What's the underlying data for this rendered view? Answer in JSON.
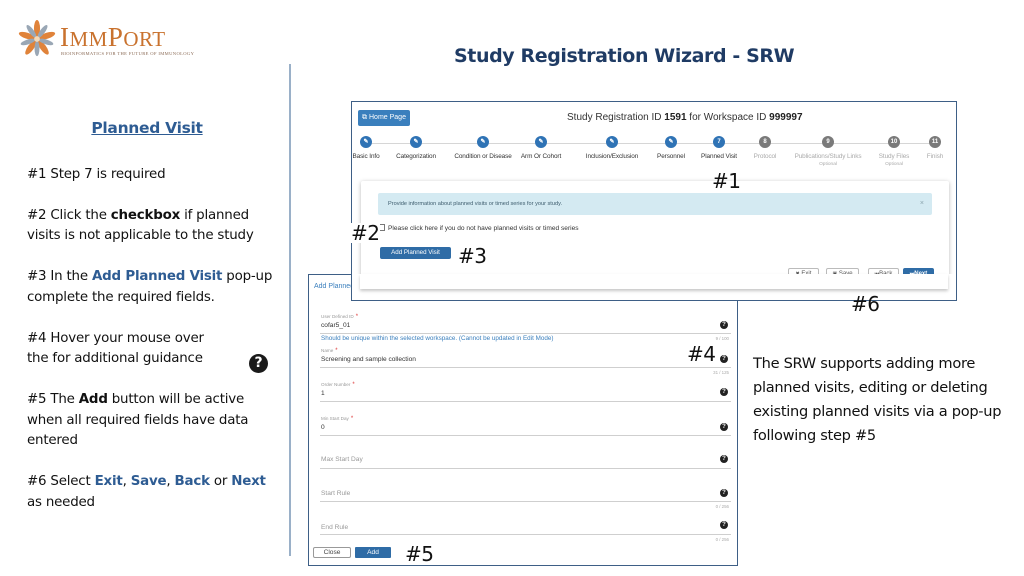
{
  "logo": {
    "name": "ImmPort",
    "name_big1": "I",
    "name_small1": "MM",
    "name_big2": "P",
    "name_small2": "ORT",
    "tagline": "Bioinformatics For The Future of Immunology",
    "icon": "immport-flower-icon"
  },
  "slide_title": "Study Registration Wizard - SRW",
  "instructions": {
    "title": "Planned Visit",
    "steps": [
      {
        "num": "#1",
        "text": " Step 7 is required"
      },
      {
        "num": "#2",
        "pre": " Click the ",
        "bold": "checkbox",
        "post": " if planned visits is not applicable to the study"
      },
      {
        "num": "#3",
        "pre": " In the ",
        "blue": "Add Planned Visit",
        "post": " pop-up complete the required fields."
      },
      {
        "num": "#4",
        "text": "  Hover your mouse over the for additional guidance"
      },
      {
        "num": "#5",
        "pre": "  The ",
        "bold": "Add",
        "post": " button will be active when all required fields have data entered"
      },
      {
        "num": "#6",
        "pre": " Select ",
        "exit": "Exit",
        "sep1": ", ",
        "save": "Save",
        "sep2": ", ",
        "back": "Back",
        "or": " or ",
        "next": "Next",
        "post": " as needed"
      }
    ],
    "help_icon": "?"
  },
  "srw": {
    "home_button": "Home Page",
    "home_icon": "external-link-icon",
    "registration_title_pre": "Study Registration ID ",
    "study_id": "1591",
    "registration_title_mid": " for Workspace ID ",
    "workspace_id": "999997",
    "steps": [
      {
        "n": "1",
        "label": "Basic Info",
        "state": "done",
        "glyph": "✎"
      },
      {
        "n": "2",
        "label": "Categorization",
        "state": "done",
        "glyph": "✎"
      },
      {
        "n": "3",
        "label": "Condition or Disease",
        "state": "done",
        "glyph": "✎"
      },
      {
        "n": "4",
        "label": "Arm Or Cohort",
        "state": "done",
        "glyph": "✎"
      },
      {
        "n": "5",
        "label": "Inclusion/Exclusion",
        "state": "done",
        "glyph": "✎"
      },
      {
        "n": "6",
        "label": "Personnel",
        "state": "done",
        "glyph": "✎"
      },
      {
        "n": "7",
        "label": "Planned Visit",
        "state": "active",
        "glyph": "7"
      },
      {
        "n": "8",
        "label": "Protocol",
        "state": "todo",
        "glyph": "8"
      },
      {
        "n": "9",
        "label": "Publications/Study Links",
        "state": "todo",
        "glyph": "9",
        "sub": "Optional"
      },
      {
        "n": "10",
        "label": "Study Files",
        "state": "todo",
        "glyph": "10",
        "sub": "Optional"
      },
      {
        "n": "11",
        "label": "Finish",
        "state": "todo",
        "glyph": "11"
      }
    ],
    "info_alert": "Provide information about planned visits or timed series for your study.",
    "alert_close": "×",
    "checkbox_label": "Please click here if you do not have planned visits or timed series",
    "checkbox_checked": false,
    "add_planned_visit_button": "Add Planned Visit",
    "nav": {
      "exit": "Exit",
      "exit_icon": "✖",
      "save": "Save",
      "save_icon": "🖫",
      "back": "Back",
      "back_icon": "⏮",
      "next": "Next",
      "next_icon": "⏭"
    }
  },
  "popup": {
    "title": "Add Planned Visit",
    "fields": [
      {
        "label": "User Defined ID",
        "required": true,
        "value": "cofar5_01",
        "counter": "9 / 100",
        "hint": "Should be unique within the selected workspace. (Cannot be updated in Edit Mode)"
      },
      {
        "label": "Name",
        "required": true,
        "value": "Screening and sample collection",
        "counter": "31 / 125"
      },
      {
        "label": "Order Number",
        "required": true,
        "value": "1"
      },
      {
        "label": "Min Start Day",
        "required": true,
        "value": "0"
      },
      {
        "label": "Max Start Day",
        "required": false,
        "placeholder": "Max Start Day"
      },
      {
        "label": "Start Rule",
        "required": false,
        "placeholder": "Start Rule",
        "counter": "0 / 256"
      },
      {
        "label": "End Rule",
        "required": false,
        "placeholder": "End Rule",
        "counter": "0 / 256"
      }
    ],
    "close_button": "Close",
    "add_button": "Add",
    "help_icon": "?",
    "required_mark": "*"
  },
  "markers": [
    "#1",
    "#2",
    "#3",
    "#4",
    "#5",
    "#6"
  ],
  "right_note": "The SRW supports adding more planned visits, editing or deleting existing planned visits via a pop-up following step #5",
  "colors": {
    "title_navy": "#1f3b64",
    "accent_blue": "#2e5c93",
    "button_blue": "#2f6ca6",
    "logo_orange": "#c9722e",
    "alert_bg": "#d4eaf2"
  }
}
